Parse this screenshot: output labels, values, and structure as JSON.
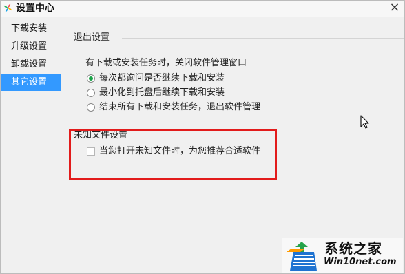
{
  "window": {
    "title": "设置中心",
    "close_symbol": "×"
  },
  "sidebar": {
    "items": [
      {
        "label": "下载安装",
        "active": false
      },
      {
        "label": "升级设置",
        "active": false
      },
      {
        "label": "卸载设置",
        "active": false
      },
      {
        "label": "其它设置",
        "active": true
      }
    ]
  },
  "main": {
    "exit_settings": {
      "title": "退出设置",
      "prompt": "有下载或安装任务时，关闭软件管理窗口",
      "options": [
        {
          "label": "每次都询问是否继续下载和安装",
          "selected": true
        },
        {
          "label": "最小化到托盘后继续下载和安装",
          "selected": false
        },
        {
          "label": "结束所有下载和安装任务，退出软件管理",
          "selected": false
        }
      ]
    },
    "unknown_file_settings": {
      "title": "未知文件设置",
      "checkbox": {
        "label": "当您打开未知文件时，为您推荐合适软件",
        "checked": false
      }
    }
  },
  "watermark": {
    "title": "系统之家",
    "subtitle": "Win10net.com"
  },
  "colors": {
    "accent": "#3399ff",
    "radio_selected": "#1aa348",
    "highlight": "#e21b1b"
  },
  "icons": {
    "app": "windmill-icon",
    "close": "close-icon",
    "cursor": "mouse-cursor-icon",
    "watermark": "house-logo-icon"
  }
}
